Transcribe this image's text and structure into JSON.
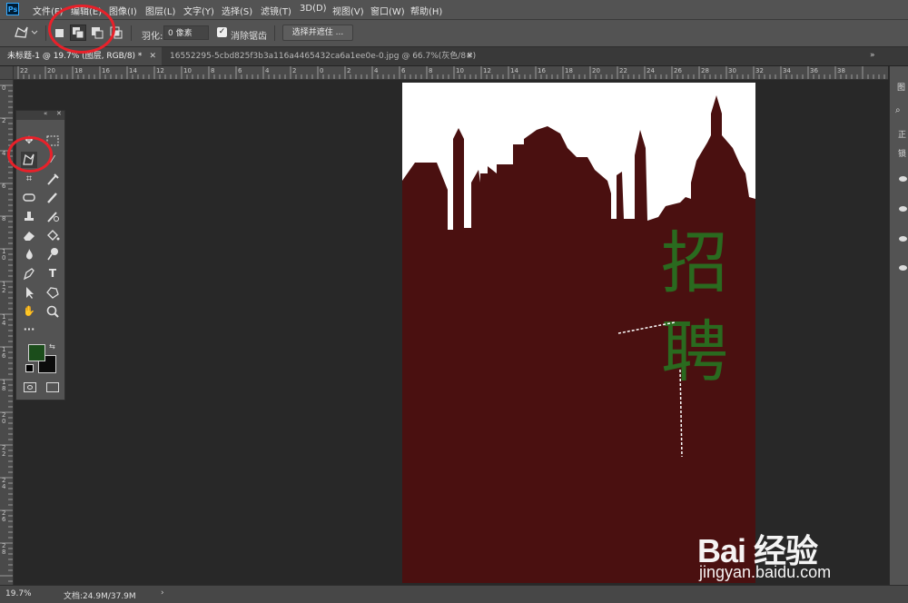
{
  "app": {
    "logo_text": "Ps"
  },
  "menubar": {
    "items": [
      {
        "label": "文件(F)"
      },
      {
        "label": "编辑(E)"
      },
      {
        "label": "图像(I)"
      },
      {
        "label": "图层(L)"
      },
      {
        "label": "文字(Y)"
      },
      {
        "label": "选择(S)"
      },
      {
        "label": "滤镜(T)"
      },
      {
        "label": "3D(D)"
      },
      {
        "label": "视图(V)"
      },
      {
        "label": "窗口(W)"
      },
      {
        "label": "帮助(H)"
      }
    ]
  },
  "options": {
    "tool_icon": "polygonal-lasso-icon",
    "selection_modes": [
      "new-selection-icon",
      "add-to-selection-icon",
      "subtract-from-selection-icon",
      "intersect-selection-icon"
    ],
    "active_mode": "add-to-selection-icon",
    "feather_label": "羽化:",
    "feather_value": "0 像素",
    "antialias_checked": true,
    "antialias_label": "消除锯齿",
    "select_mask_label": "选择并遮住 ..."
  },
  "tabs": [
    {
      "label": "未标题-1 @ 19.7% (图层, RGB/8) *",
      "active": true
    },
    {
      "label": "16552295-5cbd825f3b3a116a4465432ca6a1ee0e-0.jpg @ 66.7%(灰色/8#)",
      "active": false
    }
  ],
  "rulers": {
    "top_labels": [
      "22",
      "20",
      "18",
      "16",
      "14",
      "12",
      "10",
      "8",
      "6",
      "4",
      "2",
      "0",
      "2",
      "4",
      "6",
      "8",
      "10",
      "12",
      "14",
      "16",
      "18",
      "20",
      "22",
      "24",
      "26",
      "28",
      "30",
      "32",
      "34",
      "36",
      "38"
    ],
    "left_labels": [
      "0",
      "2",
      "4",
      "6",
      "8",
      "1 0",
      "1 2",
      "1 4",
      "1 6",
      "1 8",
      "2 0",
      "2 2",
      "2 4",
      "2 6",
      "2 8"
    ]
  },
  "document": {
    "bg_color": "#ffffff",
    "fill_color": "#4a1010",
    "text_color": "#2a6a1f",
    "headline_chars": [
      "招",
      "聘"
    ]
  },
  "toolbox": {
    "tools": [
      "move-icon",
      "marquee-icon",
      "polygonal-lasso-icon",
      "magic-wand-icon",
      "crop-icon",
      "eyedropper-icon",
      "spot-healing-icon",
      "brush-icon",
      "clone-stamp-icon",
      "history-brush-icon",
      "eraser-icon",
      "paint-bucket-icon",
      "blur-icon",
      "dodge-icon",
      "pen-icon",
      "type-icon",
      "path-selection-icon",
      "shape-icon",
      "hand-icon",
      "zoom-icon",
      "more-tools-icon"
    ],
    "fg_color": "#1b4d1b",
    "bg_color": "#0c0c0c"
  },
  "status": {
    "zoom": "19.7%",
    "doc_info": "文档:24.9M/37.9M"
  },
  "watermark": {
    "brand": "Bai 经验",
    "url": "jingyan.baidu.com"
  },
  "annotation_color": "#e8212a"
}
